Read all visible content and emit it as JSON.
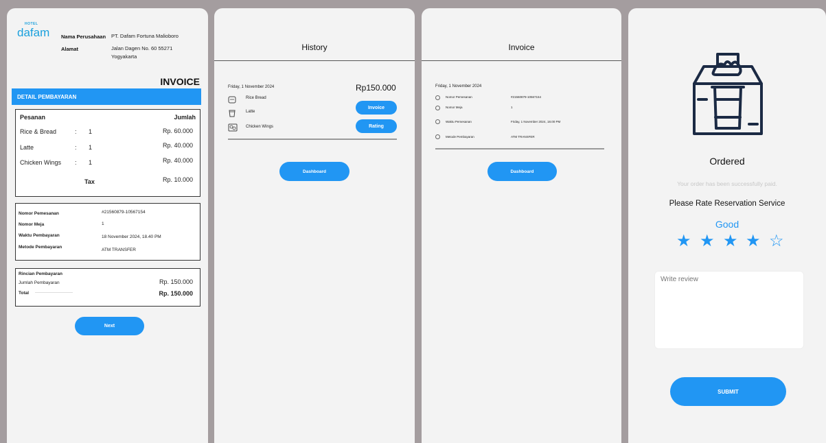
{
  "invoice_panel": {
    "logo_hotel": "HOTEL",
    "logo_brand": "dafam",
    "company_label": "Nama Perusahaan",
    "company_value": "PT. Dafam Fortuna Malioboro",
    "address_label": "Alamat",
    "address_line1": "Jalan Dagen No. 60 55271",
    "address_line2": "Yogyakarta",
    "title": "INVOICE",
    "detail_header": "DETAIL PEMBAYARAN",
    "orders_header": "Pesanan",
    "amount_header": "Jumlah",
    "orders": [
      {
        "name": "Rice & Bread",
        "sep": ":",
        "qty": "1",
        "price": "Rp. 60.000"
      },
      {
        "name": "Latte",
        "sep": ":",
        "qty": "1",
        "price": "Rp. 40.000"
      },
      {
        "name": "Chicken Wings",
        "sep": ":",
        "qty": "1",
        "price": "Rp. 40.000"
      }
    ],
    "tax_label": "Tax",
    "tax_value": "Rp. 10.000",
    "order_info": [
      {
        "label": "Nomor Pemesanan",
        "value": "#21560879-10567154"
      },
      {
        "label": "Nomor Meja",
        "value": "1"
      },
      {
        "label": "Waktu Pembayaran",
        "value": "18 November 2024, 18.40 PM"
      },
      {
        "label": "Metode Pembayaran",
        "value": "ATM TRANSFER"
      }
    ],
    "payment_title": "Rincian Pembayaran",
    "payment_amount_label": "Jumlah Pembayaran",
    "payment_amount_value": "Rp. 150.000",
    "total_label": "Total",
    "total_value": "Rp. 150.000",
    "next_label": "Next"
  },
  "history_panel": {
    "title": "History",
    "date": "Friday, 1 November 2024",
    "total": "Rp150.000",
    "items": [
      {
        "name": "Rice Bread",
        "icon": "bread-icon"
      },
      {
        "name": "Latte",
        "icon": "cup-icon"
      },
      {
        "name": "Chicken Wings",
        "icon": "chicken-icon"
      }
    ],
    "invoice_button": "Invoice",
    "rating_button": "Rating",
    "dashboard_button": "Dashboard"
  },
  "invoice_detail_panel": {
    "title": "Invoice",
    "date": "Friday, 1 November 2024",
    "rows": [
      {
        "label": "Nomor Pemesanan",
        "value": "#21560879-10567154"
      },
      {
        "label": "Nomor Meja",
        "value": "1"
      },
      {
        "label": "Waktu Pemesanan",
        "value": "Friday, 1 November 2024, 18.00 PM"
      },
      {
        "label": "Metode Pembayaran",
        "value": "ATM TRANSFER"
      }
    ],
    "dashboard_button": "Dashboard"
  },
  "ordered_panel": {
    "status": "Ordered",
    "subtitle": "Your order has been successfully paid.",
    "rate_prompt": "Please Rate Reservation Service",
    "rating_word": "Good",
    "rating": 4,
    "rating_max": 5,
    "review_placeholder": "Write review",
    "submit_label": "SUBMIT"
  },
  "colors": {
    "accent": "#2196f3",
    "background": "#a49d9f",
    "panel": "#f3f3f3"
  }
}
